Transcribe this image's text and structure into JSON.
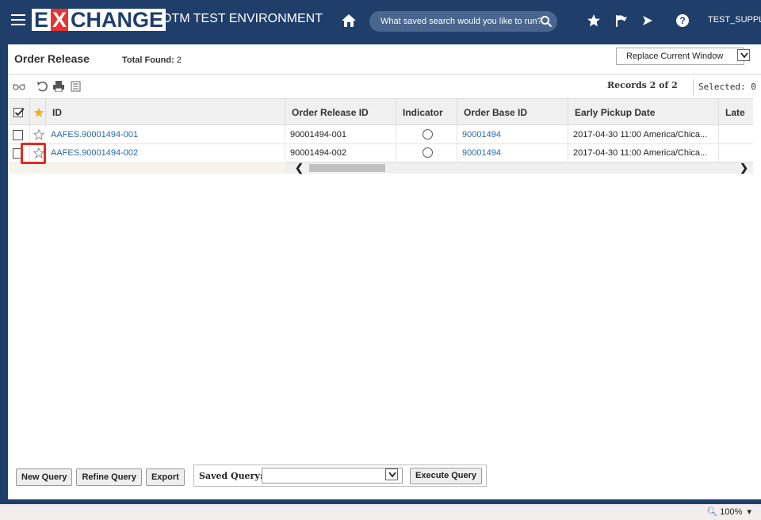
{
  "app": {
    "logo_e": "E",
    "logo_x": "X",
    "logo_rest": "CHANGE",
    "environment": "OTM TEST ENVIRONMENT",
    "search_placeholder": "What saved search would you like to run?",
    "user": "TEST_SUPPL"
  },
  "page": {
    "title": "Order Release",
    "total_found_label": "Total Found:",
    "total_found_value": "2",
    "window_option": "Replace Current Window",
    "records_label": "Records 2 of 2",
    "selected_label": "Selected: 0"
  },
  "table": {
    "columns": [
      "ID",
      "Order Release ID",
      "Indicator",
      "Order Base ID",
      "Early Pickup Date",
      "Late P"
    ],
    "rows": [
      {
        "id": "AAFES.90001494-001",
        "order_release_id": "90001494-001",
        "order_base_id": "90001494",
        "early_pickup": "2017-04-30 11:00 America/Chica..."
      },
      {
        "id": "AAFES.90001494-002",
        "order_release_id": "90001494-002",
        "order_base_id": "90001494",
        "early_pickup": "2017-04-30 11:00 America/Chica..."
      }
    ]
  },
  "bottom": {
    "new_query": "New Query",
    "refine_query": "Refine Query",
    "export": "Export",
    "saved_query_label": "Saved Query:",
    "execute_query": "Execute Query"
  },
  "status": {
    "zoom": "100%"
  },
  "colors": {
    "header_bg": "#1f3e6a",
    "link": "#2b67a6",
    "highlight": "#e32b1f"
  }
}
